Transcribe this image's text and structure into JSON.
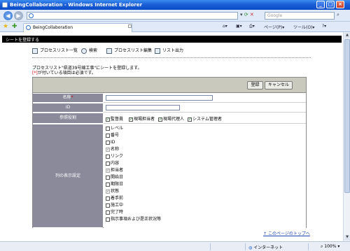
{
  "window": {
    "title": "BeingCollaboration - Windows Internet Explorer"
  },
  "addressbar": {
    "search_placeholder": "Google"
  },
  "tabbar": {
    "tab_label": "BeingCollaboration",
    "page_menu": "ページ(P)",
    "tools_menu": "ツール(O)"
  },
  "page": {
    "header_title": "シートを登録する",
    "menu": [
      {
        "label": "プロセスリスト一覧",
        "icon": "list-icon"
      },
      {
        "label": "検索",
        "icon": "search-icon"
      },
      {
        "label": "プロセスリスト編集",
        "icon": "edit-icon"
      },
      {
        "label": "リスト出力",
        "icon": "export-icon"
      }
    ],
    "notice_line1": "プロセスリスト\"県道39号線工事\"にシートを登録します。",
    "notice_req_mark": "[*]",
    "notice_line2_rest": "が付いている項目は必須です。",
    "buttons": {
      "register": "登録",
      "cancel": "キャンセル"
    },
    "form": {
      "name_label": "名称",
      "name_required_mark": "*",
      "id_label": "ID",
      "role_label": "参照役割",
      "roles": [
        {
          "label": "監督員",
          "checked": true
        },
        {
          "label": "現場担当者",
          "checked": true
        },
        {
          "label": "現場代理人",
          "checked": true
        },
        {
          "label": "システム管理者",
          "checked": true
        }
      ],
      "columns_label": "列の表示設定",
      "columns": [
        {
          "label": "レベル",
          "checked": false,
          "disabled": false
        },
        {
          "label": "番号",
          "checked": false,
          "disabled": false
        },
        {
          "label": "ID",
          "checked": false,
          "disabled": false
        },
        {
          "label": "名称",
          "checked": true,
          "disabled": true
        },
        {
          "label": "リンク",
          "checked": false,
          "disabled": false
        },
        {
          "label": "内容",
          "checked": false,
          "disabled": false
        },
        {
          "label": "担当者",
          "checked": true,
          "disabled": true
        },
        {
          "label": "開始日",
          "checked": false,
          "disabled": false
        },
        {
          "label": "期限日",
          "checked": false,
          "disabled": false
        },
        {
          "label": "状態",
          "checked": true,
          "disabled": true
        },
        {
          "label": "着手前",
          "checked": false,
          "disabled": false
        },
        {
          "label": "施工中",
          "checked": false,
          "disabled": false
        },
        {
          "label": "完了時",
          "checked": false,
          "disabled": false
        },
        {
          "label": "指示事項および是正状況等",
          "checked": false,
          "disabled": false
        }
      ]
    },
    "page_top_link": "このページのトップへ"
  },
  "statusbar": {
    "zone": "インターネット",
    "zoom": "100%"
  }
}
